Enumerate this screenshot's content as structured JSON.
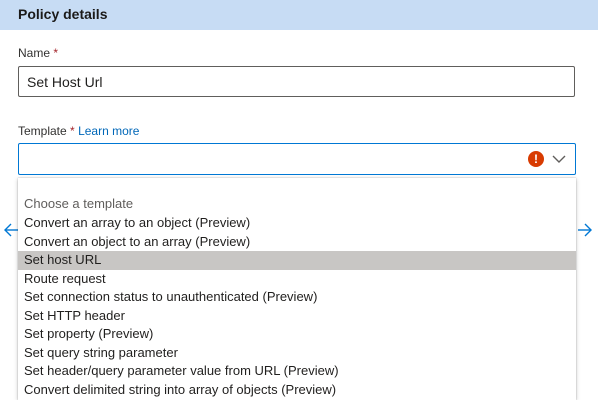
{
  "header": {
    "title": "Policy details"
  },
  "name_field": {
    "label": "Name",
    "required_mark": "*",
    "value": "Set Host Url"
  },
  "template_field": {
    "label": "Template",
    "required_mark": "*",
    "learn_more": "Learn more",
    "value": "",
    "error_icon": "error-icon",
    "error_color": "#d83b01"
  },
  "dropdown": {
    "header": "Choose a template",
    "selected_index": 2,
    "items": [
      "Convert an array to an object (Preview)",
      "Convert an object to an array (Preview)",
      "Set host URL",
      "Route request",
      "Set connection status to unauthenticated (Preview)",
      "Set HTTP header",
      "Set property (Preview)",
      "Set query string parameter",
      "Set header/query parameter value from URL (Preview)",
      "Convert delimited string into array of objects (Preview)"
    ]
  },
  "colors": {
    "header_bg": "#c7dcf4",
    "accent": "#0078d4",
    "selected_bg": "#c8c6c4"
  },
  "nav": {
    "prev_icon": "arrow-left-icon",
    "next_icon": "arrow-right-icon"
  }
}
